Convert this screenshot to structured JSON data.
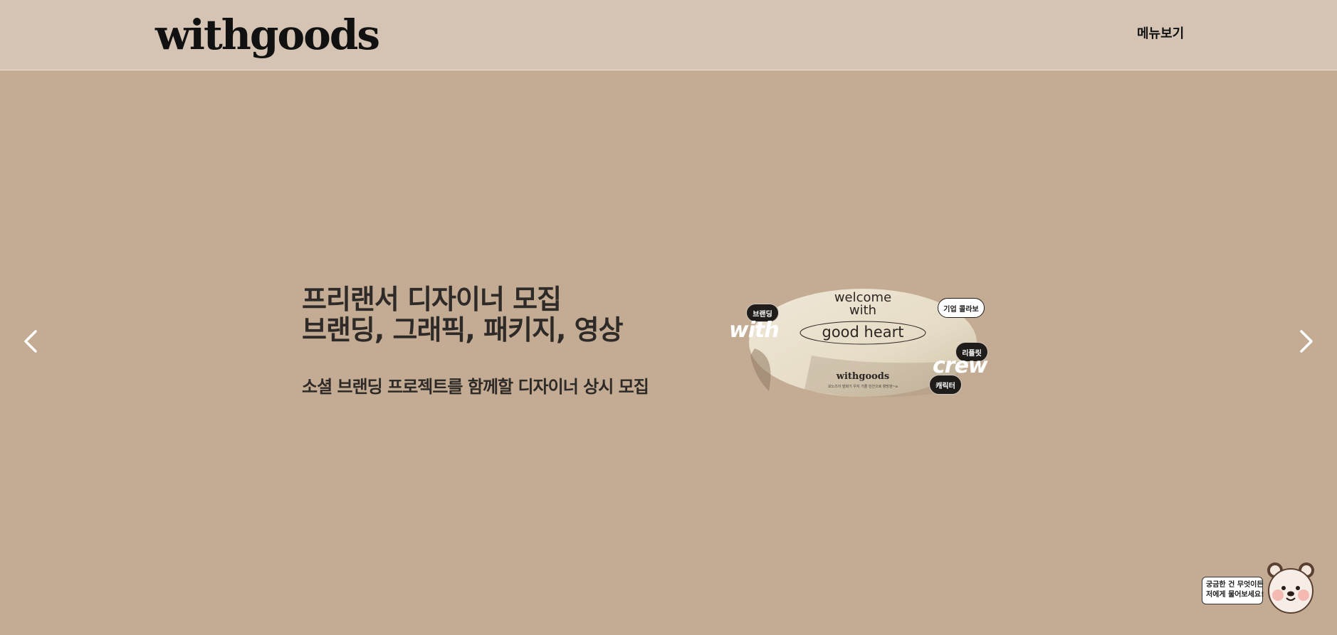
{
  "header": {
    "logo_text": "withgoods",
    "menu_label": "메뉴보기"
  },
  "hero": {
    "title_lines": [
      "프리랜서 디자이너 모집",
      "브랜딩, 그래픽, 패키지, 영상"
    ],
    "subtitle": "소셜 브랜딩 프로젝트를 함께할 디자이너 상시 모집",
    "prev_icon": "chevron-left-icon",
    "next_icon": "chevron-right-icon"
  },
  "visual": {
    "box_text_top": [
      "welcome",
      "with"
    ],
    "box_text_oval": "good heart",
    "box_brand": "withgoods",
    "box_small_text": "모노즈이 발화기 우지 가줄 민간으로 향방현~a",
    "tags": [
      "브랜딩",
      "기업 콜라보",
      "리플릿",
      "캐릭터"
    ],
    "words": [
      "with",
      "crew"
    ]
  },
  "chatbot": {
    "bubble_lines": [
      "궁금한 건 무엇이든",
      "저에게 물어보세요!"
    ]
  },
  "colors": {
    "header_bg": "#d5c4b4",
    "hero_bg": "#c4ac94",
    "text_dark": "#2d2a27"
  }
}
